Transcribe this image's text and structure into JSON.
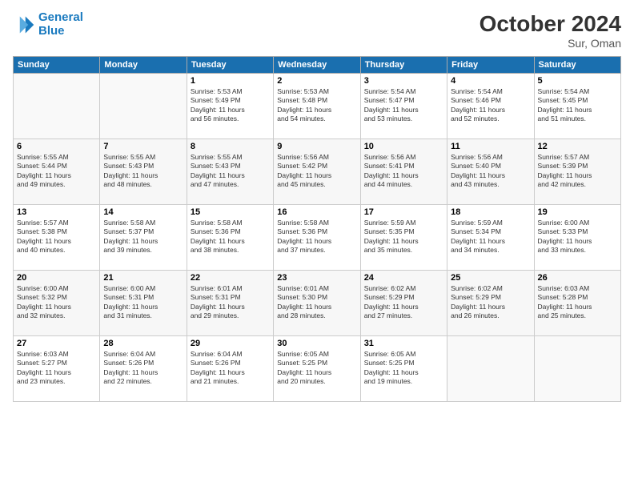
{
  "header": {
    "logo_line1": "General",
    "logo_line2": "Blue",
    "month_title": "October 2024",
    "location": "Sur, Oman"
  },
  "days_of_week": [
    "Sunday",
    "Monday",
    "Tuesday",
    "Wednesday",
    "Thursday",
    "Friday",
    "Saturday"
  ],
  "weeks": [
    [
      {
        "day": "",
        "info": ""
      },
      {
        "day": "",
        "info": ""
      },
      {
        "day": "1",
        "info": "Sunrise: 5:53 AM\nSunset: 5:49 PM\nDaylight: 11 hours\nand 56 minutes."
      },
      {
        "day": "2",
        "info": "Sunrise: 5:53 AM\nSunset: 5:48 PM\nDaylight: 11 hours\nand 54 minutes."
      },
      {
        "day": "3",
        "info": "Sunrise: 5:54 AM\nSunset: 5:47 PM\nDaylight: 11 hours\nand 53 minutes."
      },
      {
        "day": "4",
        "info": "Sunrise: 5:54 AM\nSunset: 5:46 PM\nDaylight: 11 hours\nand 52 minutes."
      },
      {
        "day": "5",
        "info": "Sunrise: 5:54 AM\nSunset: 5:45 PM\nDaylight: 11 hours\nand 51 minutes."
      }
    ],
    [
      {
        "day": "6",
        "info": "Sunrise: 5:55 AM\nSunset: 5:44 PM\nDaylight: 11 hours\nand 49 minutes."
      },
      {
        "day": "7",
        "info": "Sunrise: 5:55 AM\nSunset: 5:43 PM\nDaylight: 11 hours\nand 48 minutes."
      },
      {
        "day": "8",
        "info": "Sunrise: 5:55 AM\nSunset: 5:43 PM\nDaylight: 11 hours\nand 47 minutes."
      },
      {
        "day": "9",
        "info": "Sunrise: 5:56 AM\nSunset: 5:42 PM\nDaylight: 11 hours\nand 45 minutes."
      },
      {
        "day": "10",
        "info": "Sunrise: 5:56 AM\nSunset: 5:41 PM\nDaylight: 11 hours\nand 44 minutes."
      },
      {
        "day": "11",
        "info": "Sunrise: 5:56 AM\nSunset: 5:40 PM\nDaylight: 11 hours\nand 43 minutes."
      },
      {
        "day": "12",
        "info": "Sunrise: 5:57 AM\nSunset: 5:39 PM\nDaylight: 11 hours\nand 42 minutes."
      }
    ],
    [
      {
        "day": "13",
        "info": "Sunrise: 5:57 AM\nSunset: 5:38 PM\nDaylight: 11 hours\nand 40 minutes."
      },
      {
        "day": "14",
        "info": "Sunrise: 5:58 AM\nSunset: 5:37 PM\nDaylight: 11 hours\nand 39 minutes."
      },
      {
        "day": "15",
        "info": "Sunrise: 5:58 AM\nSunset: 5:36 PM\nDaylight: 11 hours\nand 38 minutes."
      },
      {
        "day": "16",
        "info": "Sunrise: 5:58 AM\nSunset: 5:36 PM\nDaylight: 11 hours\nand 37 minutes."
      },
      {
        "day": "17",
        "info": "Sunrise: 5:59 AM\nSunset: 5:35 PM\nDaylight: 11 hours\nand 35 minutes."
      },
      {
        "day": "18",
        "info": "Sunrise: 5:59 AM\nSunset: 5:34 PM\nDaylight: 11 hours\nand 34 minutes."
      },
      {
        "day": "19",
        "info": "Sunrise: 6:00 AM\nSunset: 5:33 PM\nDaylight: 11 hours\nand 33 minutes."
      }
    ],
    [
      {
        "day": "20",
        "info": "Sunrise: 6:00 AM\nSunset: 5:32 PM\nDaylight: 11 hours\nand 32 minutes."
      },
      {
        "day": "21",
        "info": "Sunrise: 6:00 AM\nSunset: 5:31 PM\nDaylight: 11 hours\nand 31 minutes."
      },
      {
        "day": "22",
        "info": "Sunrise: 6:01 AM\nSunset: 5:31 PM\nDaylight: 11 hours\nand 29 minutes."
      },
      {
        "day": "23",
        "info": "Sunrise: 6:01 AM\nSunset: 5:30 PM\nDaylight: 11 hours\nand 28 minutes."
      },
      {
        "day": "24",
        "info": "Sunrise: 6:02 AM\nSunset: 5:29 PM\nDaylight: 11 hours\nand 27 minutes."
      },
      {
        "day": "25",
        "info": "Sunrise: 6:02 AM\nSunset: 5:29 PM\nDaylight: 11 hours\nand 26 minutes."
      },
      {
        "day": "26",
        "info": "Sunrise: 6:03 AM\nSunset: 5:28 PM\nDaylight: 11 hours\nand 25 minutes."
      }
    ],
    [
      {
        "day": "27",
        "info": "Sunrise: 6:03 AM\nSunset: 5:27 PM\nDaylight: 11 hours\nand 23 minutes."
      },
      {
        "day": "28",
        "info": "Sunrise: 6:04 AM\nSunset: 5:26 PM\nDaylight: 11 hours\nand 22 minutes."
      },
      {
        "day": "29",
        "info": "Sunrise: 6:04 AM\nSunset: 5:26 PM\nDaylight: 11 hours\nand 21 minutes."
      },
      {
        "day": "30",
        "info": "Sunrise: 6:05 AM\nSunset: 5:25 PM\nDaylight: 11 hours\nand 20 minutes."
      },
      {
        "day": "31",
        "info": "Sunrise: 6:05 AM\nSunset: 5:25 PM\nDaylight: 11 hours\nand 19 minutes."
      },
      {
        "day": "",
        "info": ""
      },
      {
        "day": "",
        "info": ""
      }
    ]
  ]
}
